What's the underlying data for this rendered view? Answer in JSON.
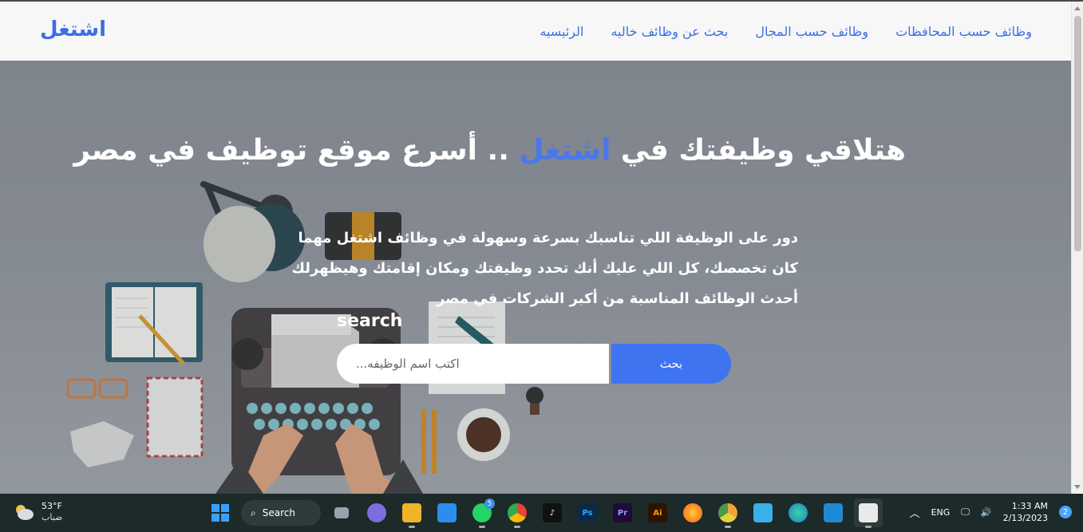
{
  "header": {
    "brand": "اشتغل",
    "nav": [
      {
        "label": "الرئيسيه"
      },
      {
        "label": "بحث عن وظائف خاليه"
      },
      {
        "label": "وظائف حسب المجال"
      },
      {
        "label": "وظائف حسب المحافظات"
      }
    ]
  },
  "hero": {
    "headline_part1": "هتلاقي وظيفتك في ",
    "headline_accent": "اشتغل",
    "headline_part2": " .. أسرع موقع توظيف في مصر",
    "subtext": "دور على الوظيفة اللي تناسبك بسرعة وسهولة في وظائف اشتغل مهما كان تخصصك، كل اللي عليك أنك تحدد وظيفتك ومكان إقامتك وهيظهرلك أحدث الوظائف المناسبة من أكبر الشركات في مصر",
    "search_label": "search",
    "search_placeholder": "اكتب اسم الوظيفه...",
    "search_button": "بحث"
  },
  "taskbar": {
    "weather_temp": "53°F",
    "weather_desc": "ضباب",
    "search_label": "Search",
    "whatsapp_badge": "5",
    "language": "ENG",
    "time": "1:33 AM",
    "date": "2/13/2023",
    "notification_count": "2"
  },
  "colors": {
    "accent": "#3d6fe0",
    "button": "#3f74f0",
    "taskbar": "#1c2a2a"
  }
}
